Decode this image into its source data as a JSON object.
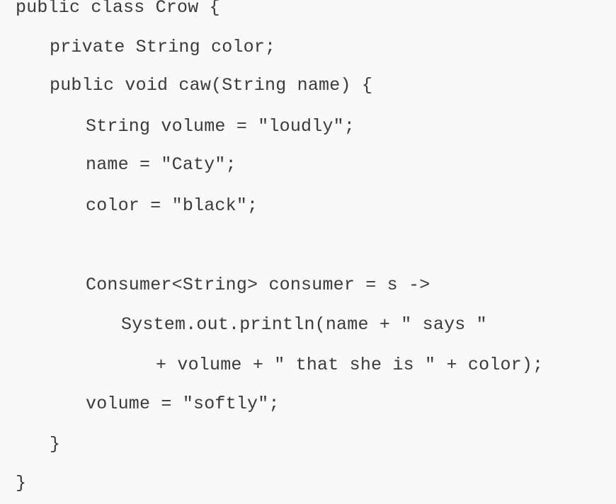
{
  "code": {
    "lines": [
      "public class Crow {",
      "private String color;",
      "public void caw(String name) {",
      "String volume = \"loudly\";",
      "name = \"Caty\";",
      "color = \"black\";",
      "Consumer<String> consumer = s ->",
      "System.out.println(name + \" says \"",
      "+ volume + \" that she is \" + color);",
      "volume = \"softly\";",
      "}",
      "}"
    ]
  }
}
